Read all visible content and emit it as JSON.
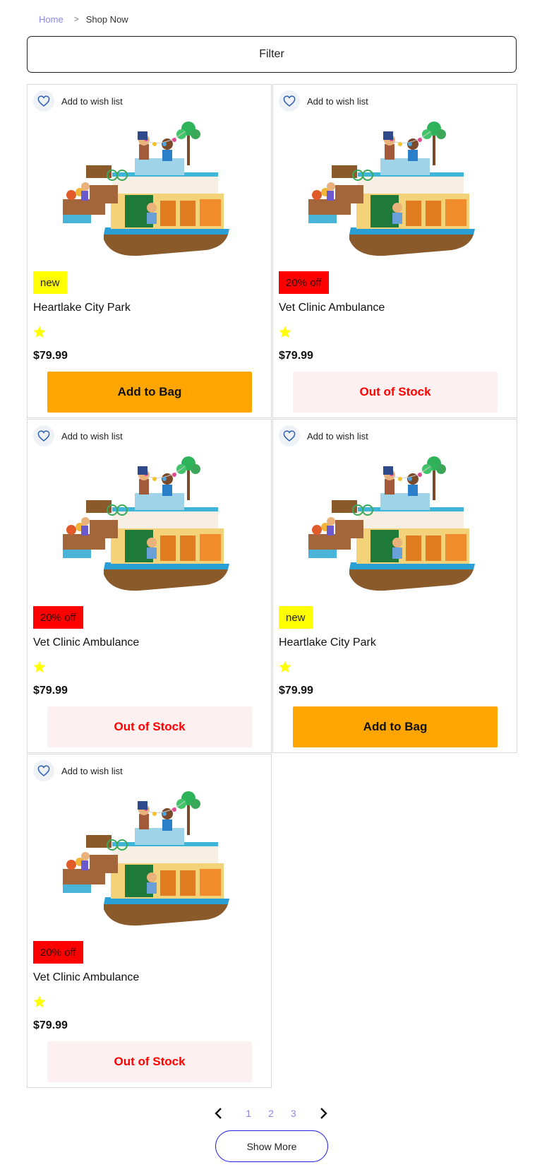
{
  "breadcrumb": {
    "home": "Home",
    "separator": ">",
    "current": "Shop Now"
  },
  "filter": {
    "label": "Filter"
  },
  "products": [
    {
      "badge": "new",
      "badge_type": "new",
      "title": "Heartlake City Park",
      "rating": 1,
      "price": "$79.99",
      "button": "Add to Bag",
      "button_type": "add",
      "wish": "Add to wish list"
    },
    {
      "badge": "20% off",
      "badge_type": "sale",
      "title": "Vet Clinic Ambulance",
      "rating": 1,
      "price": "$79.99",
      "button": "Out of Stock",
      "button_type": "oos",
      "wish": "Add to wish list"
    },
    {
      "badge": "20% off",
      "badge_type": "sale",
      "title": "Vet Clinic Ambulance",
      "rating": 1,
      "price": "$79.99",
      "button": "Out of Stock",
      "button_type": "oos",
      "wish": "Add to wish list"
    },
    {
      "badge": "new",
      "badge_type": "new",
      "title": "Heartlake City Park",
      "rating": 1,
      "price": "$79.99",
      "button": "Add to Bag",
      "button_type": "add",
      "wish": "Add to wish list"
    },
    {
      "badge": "20% off",
      "badge_type": "sale",
      "title": "Vet Clinic Ambulance",
      "rating": 1,
      "price": "$79.99",
      "button": "Out of Stock",
      "button_type": "oos",
      "wish": "Add to wish list"
    }
  ],
  "pagination": {
    "pages": [
      "1",
      "2",
      "3"
    ]
  },
  "show_more": {
    "label": "Show More"
  },
  "colors": {
    "accent": "#8b87e8",
    "add_to_bag": "#ffa500",
    "out_of_stock_text": "#ff0000",
    "out_of_stock_bg": "#fdf0f0",
    "badge_new": "#ffff00",
    "badge_sale": "#ff0000",
    "star": "#ffff00",
    "show_more_border": "#2323e6"
  },
  "icons": {
    "wish": "heart-icon",
    "rating": "star-icon",
    "prev": "chevron-left-icon",
    "next": "chevron-right-icon"
  }
}
